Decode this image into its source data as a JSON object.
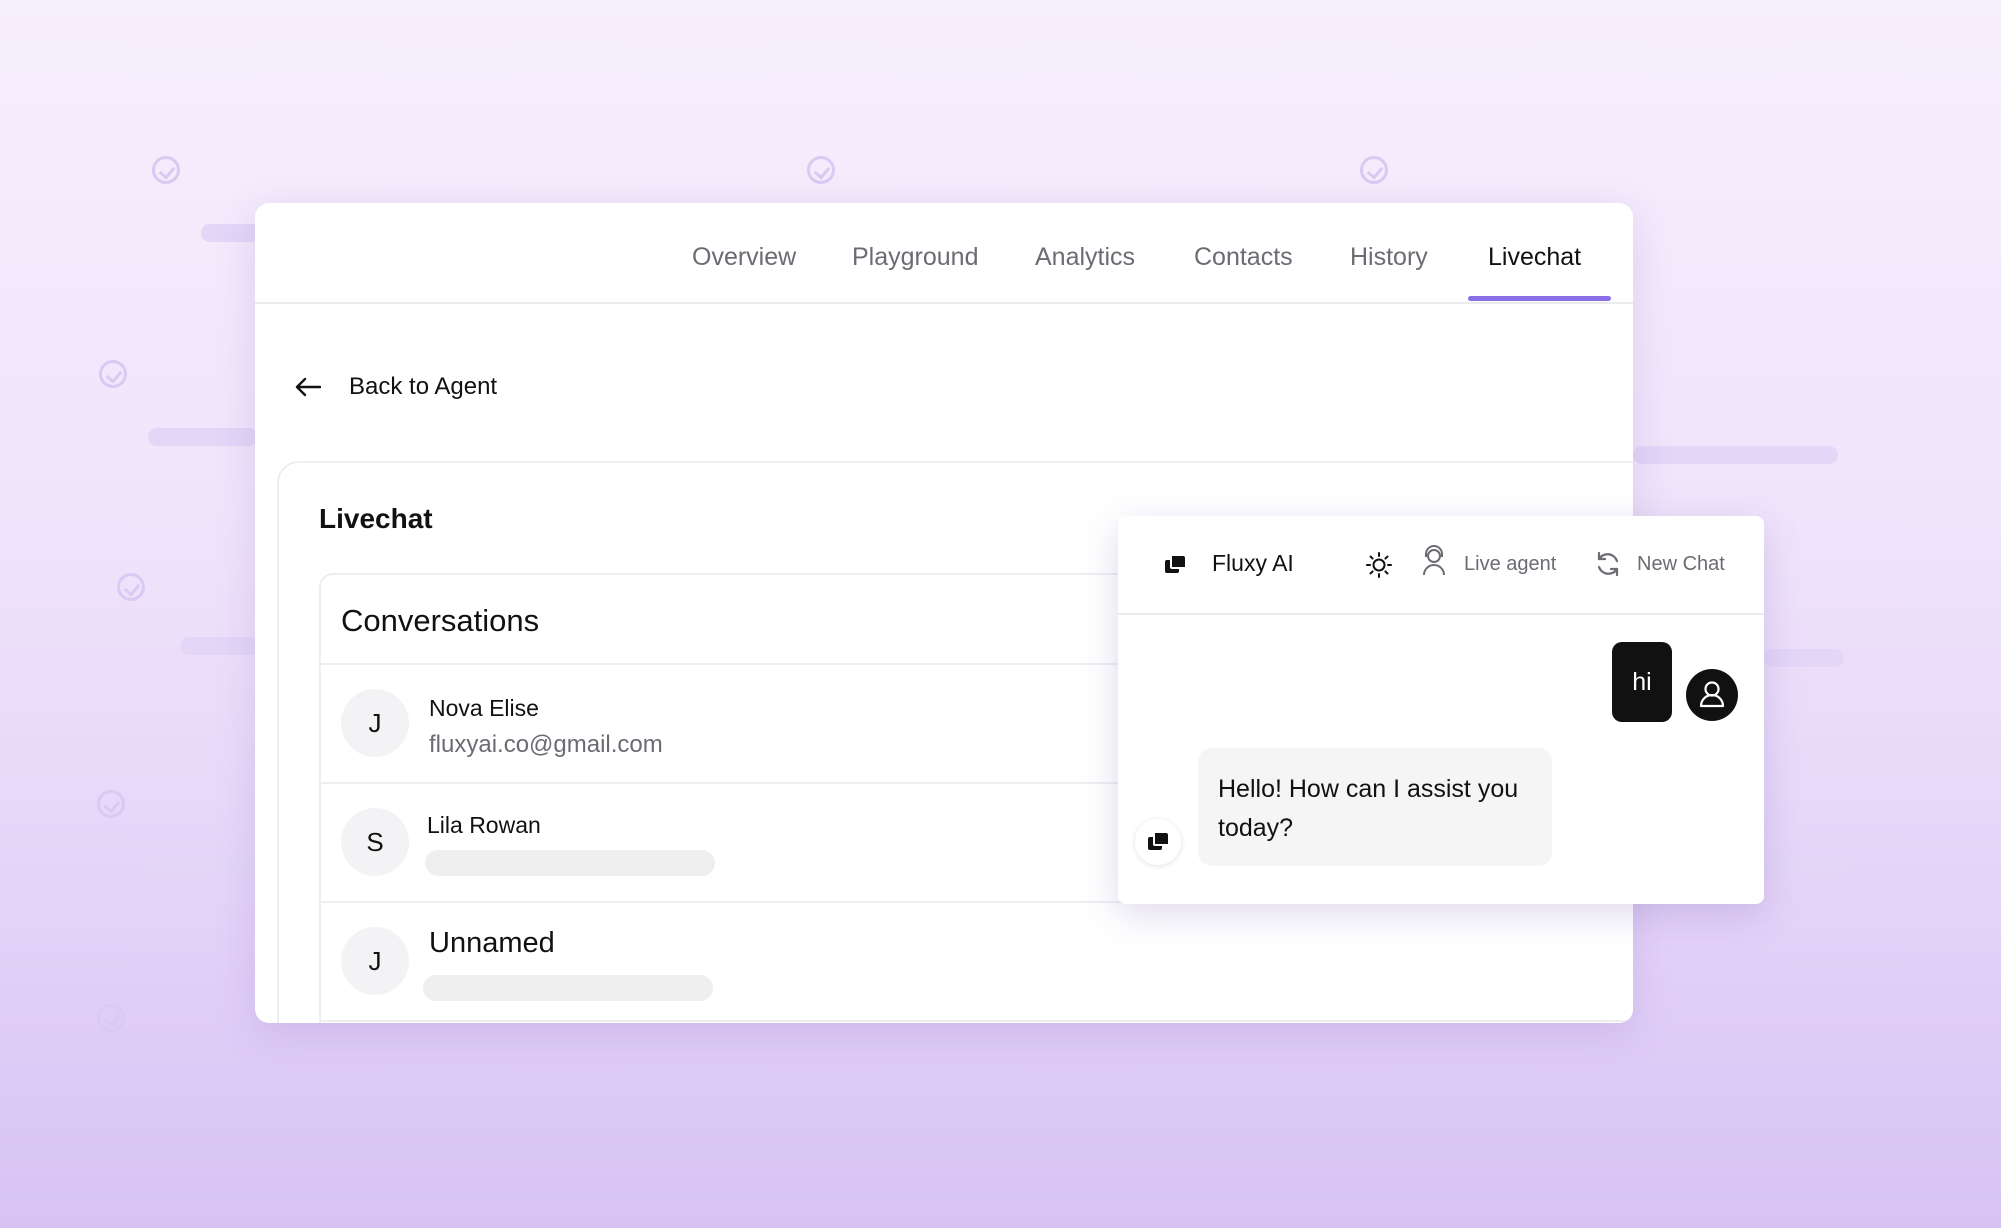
{
  "nav": {
    "tabs": [
      "Overview",
      "Playground",
      "Analytics",
      "Contacts",
      "History",
      "Livechat"
    ],
    "active_tab": "Livechat"
  },
  "back_link": {
    "label": "Back to Agent",
    "icon": "arrow-left-icon"
  },
  "livechat": {
    "title": "Livechat",
    "conversations_title": "Conversations",
    "conversations": [
      {
        "initial": "J",
        "name": "Nova Elise",
        "email": "fluxyai.co@gmail.com"
      },
      {
        "initial": "S",
        "name": "Lila Rowan",
        "email": ""
      },
      {
        "initial": "J",
        "name": "Unnamed",
        "email": ""
      }
    ]
  },
  "chat_widget": {
    "title": "Fluxy AI",
    "logo_icon": "fluxy-logo-icon",
    "theme_icon": "sun-icon",
    "live_agent_label": "Live agent",
    "live_agent_icon": "headset-agent-icon",
    "new_chat_label": "New Chat",
    "new_chat_icon": "refresh-icon",
    "messages": [
      {
        "from": "user",
        "text": "hi"
      },
      {
        "from": "bot",
        "text": "Hello! How can I assist you today?"
      }
    ]
  },
  "colors": {
    "accent": "#8b6fe6",
    "background_top": "#f6effd",
    "background_bottom": "#d7c2f4",
    "user_bubble": "#111111",
    "bot_bubble": "#f5f5f6"
  }
}
